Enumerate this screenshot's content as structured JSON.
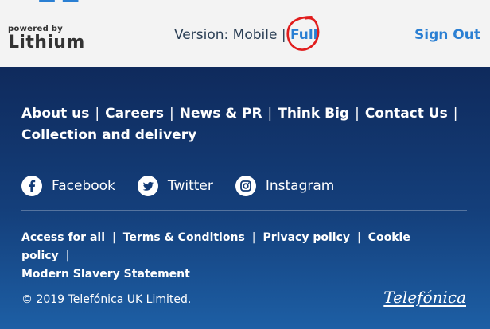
{
  "topbar": {
    "brand_small": "powered by",
    "brand_big": "Lithium",
    "version_label": "Version:",
    "version_mobile": "Mobile",
    "version_sep": "|",
    "version_full": "Full",
    "signout": "Sign Out",
    "colors": {
      "link": "#2a7fd3",
      "annotation": "#e11d1d"
    }
  },
  "footer": {
    "nav": [
      "About us",
      "Careers",
      "News & PR",
      "Think Big",
      "Contact Us",
      "Collection and delivery"
    ],
    "social": [
      {
        "label": "Facebook",
        "icon": "facebook-icon"
      },
      {
        "label": "Twitter",
        "icon": "twitter-icon"
      },
      {
        "label": "Instagram",
        "icon": "instagram-icon"
      }
    ],
    "legal": [
      "Access for all",
      "Terms & Conditions",
      "Privacy policy",
      "Cookie policy",
      "Modern Slavery Statement"
    ],
    "copyright": "© 2019 Telefónica UK Limited.",
    "brand": "Telefónica",
    "sep": "|"
  }
}
